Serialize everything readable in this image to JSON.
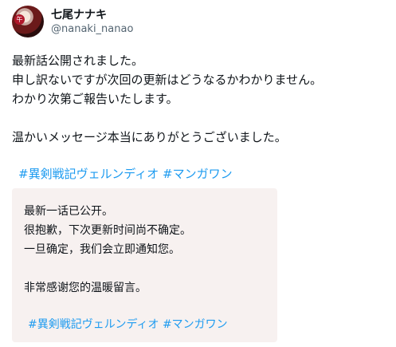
{
  "user": {
    "display_name": "七尾ナナキ",
    "handle": "@nanaki_nanao",
    "avatar_seal": "午"
  },
  "tweet": {
    "text": "最新話公開されました。\n申し訳ないですが次回の更新はどうなるかわかりません。\nわかり次第ご報告いたします。\n\n温かいメッセージ本当にありがとうございました。",
    "hashtags": [
      "#異剣戦記ヴェルンディオ",
      "#マンガワン"
    ]
  },
  "translation": {
    "text": "最新一话已公开。\n很抱歉，下次更新时间尚不确定。\n一旦确定，我们会立即通知您。\n\n非常感谢您的温暖留言。",
    "hashtags": [
      "#異剣戦記ヴェルンディオ",
      "#マンガワン"
    ]
  },
  "colors": {
    "link": "#1d9bf0",
    "handle": "#536471",
    "translation_bg": "#f7f1f0"
  }
}
